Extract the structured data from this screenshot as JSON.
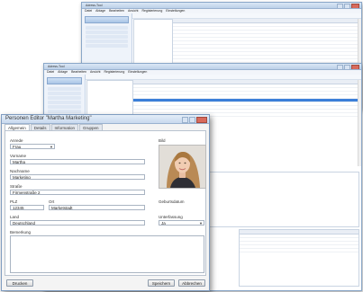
{
  "windows": {
    "back": {
      "title": "Adress-Tool",
      "menu": [
        "Datei",
        "Ablage",
        "Bearbeiten",
        "Ansicht",
        "Registerierung",
        "Einstellungen"
      ]
    },
    "mid": {
      "title": "Adress-Tool",
      "menu": [
        "Datei",
        "Ablage",
        "Bearbeiten",
        "Ansicht",
        "Registerierung",
        "Einstellungen"
      ]
    }
  },
  "dialog": {
    "title": "Personen Editor \"Martha Marketing\"",
    "tabs": [
      "Allgemein",
      "Details",
      "Information",
      "Gruppen"
    ],
    "fields": {
      "anrede_label": "Anrede",
      "anrede_value": "Frau",
      "vorname_label": "Vorname",
      "vorname_value": "Martha",
      "nachname_label": "Nachname",
      "nachname_value": "Marketing",
      "strasse_label": "Straße",
      "strasse_value": "Firmenstraße 2",
      "plz_label": "PLZ",
      "plz_value": "12345",
      "ort_label": "Ort",
      "ort_value": "Marketstadt",
      "land_label": "Land",
      "land_value": "Deutschland",
      "bemerkung_label": "Bemerkung",
      "bild_label": "Bild",
      "geburtsdatum_label": "Geburtsdatum",
      "zeichnung_label": "Unterfassung",
      "zeichnung_value": "Ja"
    },
    "buttons": {
      "print": "Drucken",
      "save": "Speichern",
      "cancel": "Abbrechen"
    }
  },
  "colors": {
    "accent": "#3b7fd9",
    "close": "#d86a5c",
    "frame": "#8aa7c8"
  }
}
